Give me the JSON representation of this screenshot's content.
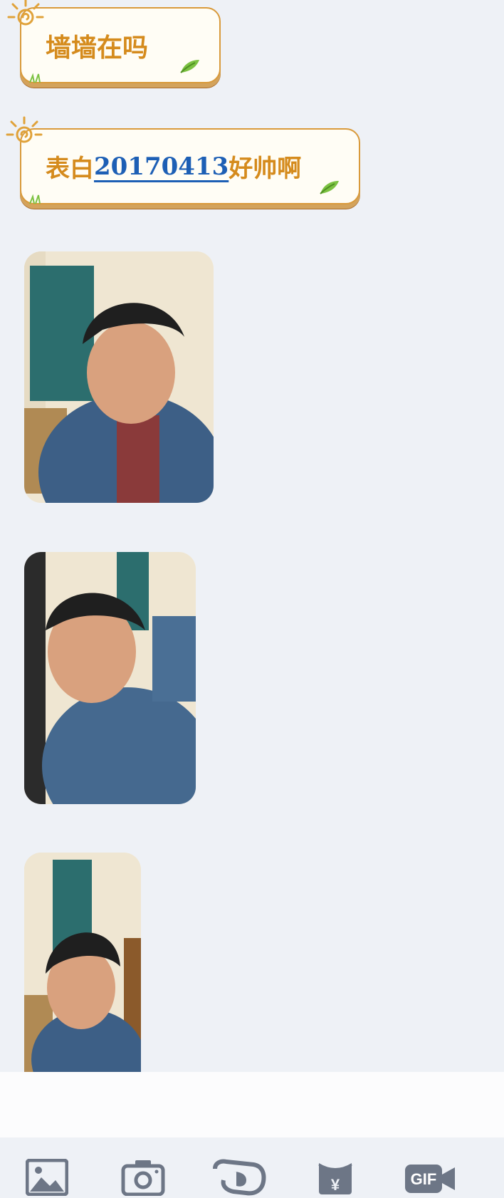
{
  "messages": [
    {
      "text": "墙墙在吗"
    },
    {
      "prefix": "表白",
      "link": "20170413",
      "suffix": "好帅啊"
    }
  ],
  "images": [
    {
      "description": "photo"
    },
    {
      "description": "photo"
    },
    {
      "description": "photo"
    }
  ],
  "input": {
    "placeholder": ""
  },
  "toolbar": {
    "icons": [
      "image-icon",
      "camera-icon",
      "voice-icon",
      "red-packet-icon",
      "gif-icon"
    ],
    "gif_label": "GIF",
    "red_packet_symbol": "¥"
  },
  "colors": {
    "background": "#eef1f6",
    "bubble_text": "#d58b1d",
    "link": "#1d5fb5",
    "icon": "#6d7686"
  }
}
